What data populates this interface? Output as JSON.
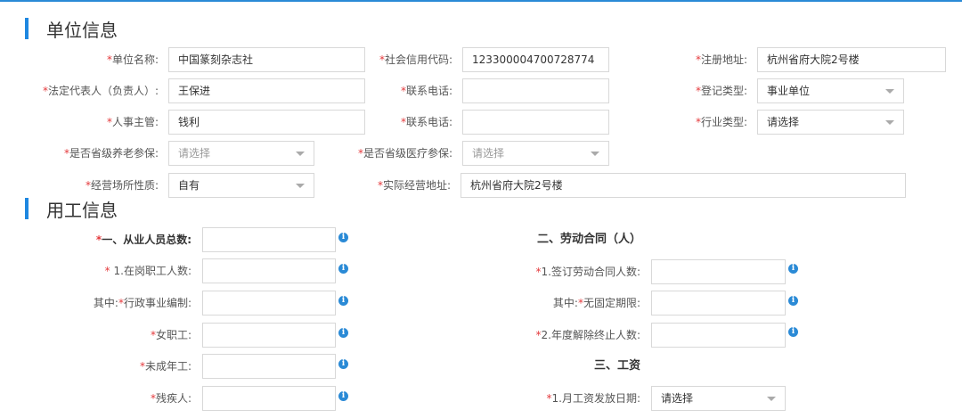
{
  "sections": {
    "unit_title": "单位信息",
    "employment_title": "用工信息"
  },
  "unit": {
    "name_label": "单位名称:",
    "name_value": "中国篆刻杂志社",
    "credit_label": "社会信用代码:",
    "credit_value": "123300004700728774",
    "address_label": "注册地址:",
    "address_value": "杭州省府大院2号楼",
    "legal_label": "法定代表人（负责人）:",
    "legal_value": "王保进",
    "phone1_label": "联系电话:",
    "phone1_value": "",
    "reg_type_label": "登记类型:",
    "reg_type_value": "事业单位",
    "hr_label": "人事主管:",
    "hr_value": "钱利",
    "phone2_label": "联系电话:",
    "phone2_value": "",
    "industry_label": "行业类型:",
    "industry_value": "请选择",
    "pension_label": "是否省级养老参保:",
    "pension_value": "请选择",
    "medical_label": "是否省级医疗参保:",
    "medical_value": "请选择",
    "premises_label": "经营场所性质:",
    "premises_value": "自有",
    "actual_addr_label": "实际经营地址:",
    "actual_addr_value": "杭州省府大院2号楼"
  },
  "employment": {
    "total_label": "一、从业人员总数:",
    "on_job_label": "1.在岗职工人数:",
    "admin_prefix": "其中:",
    "admin_label": "行政事业编制:",
    "female_label": "女职工:",
    "minor_label": "未成年工:",
    "disabled_label": "残疾人:",
    "contract_head": "二、劳动合同（人）",
    "signed_label": "1.签订劳动合同人数:",
    "open_prefix": "其中:",
    "open_label": "无固定期限:",
    "terminated_label": "2.年度解除终止人数:",
    "wage_head": "三、工资",
    "pay_date_label": "1.月工资发放日期:",
    "pay_date_value": "请选择"
  },
  "icons": {
    "info": "info-icon",
    "dropdown": "chevron-down-icon"
  },
  "colors": {
    "accent": "#1e87e0",
    "required": "#e4393c"
  }
}
